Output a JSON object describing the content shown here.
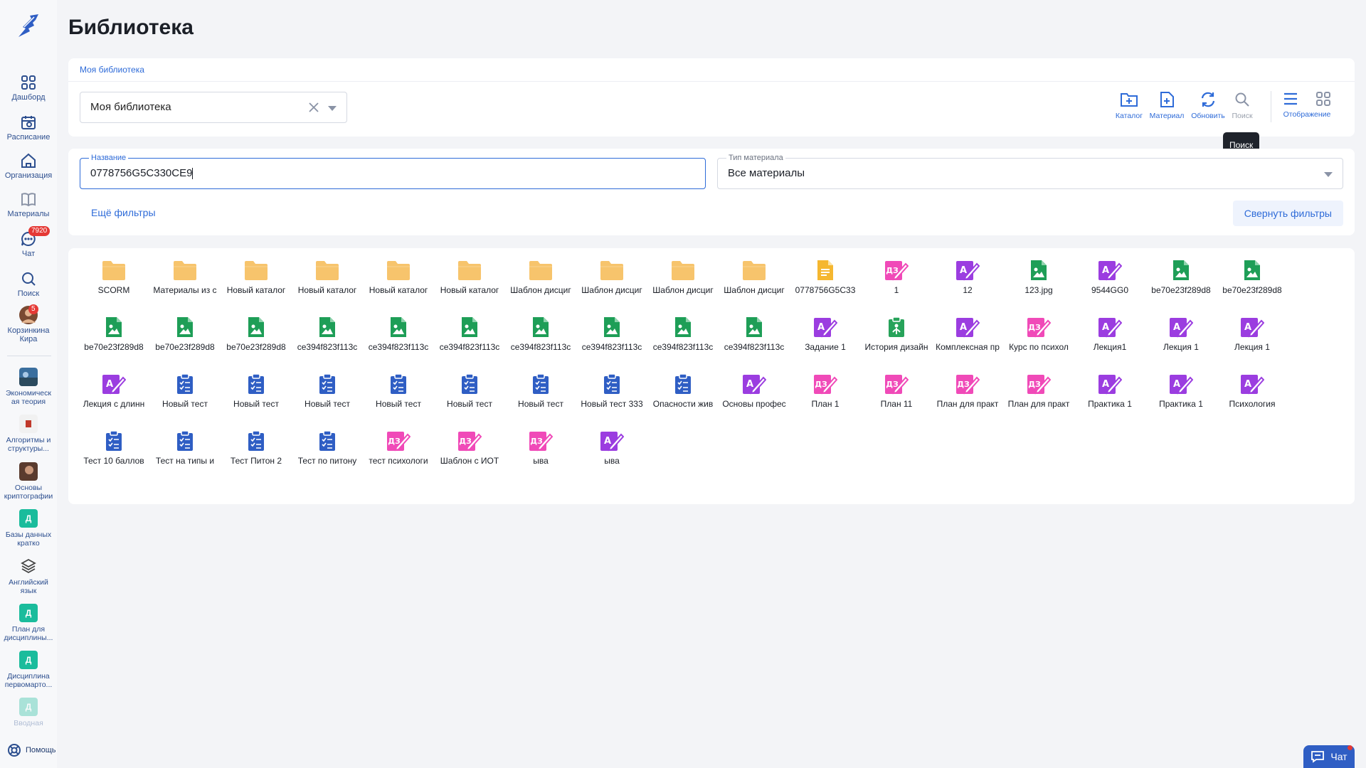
{
  "sidebar": {
    "nav": [
      {
        "label": "Дашборд",
        "icon": "dashboard-icon"
      },
      {
        "label": "Расписание",
        "icon": "calendar-icon"
      },
      {
        "label": "Организация",
        "icon": "home-icon"
      },
      {
        "label": "Материалы",
        "icon": "book-icon"
      },
      {
        "label": "Чат",
        "icon": "chat-icon",
        "badge": "7920"
      },
      {
        "label": "Поиск",
        "icon": "search-icon"
      },
      {
        "label": "Корзинкина Кира",
        "icon": "avatar",
        "badge": "5"
      }
    ],
    "courses": [
      {
        "label": "Экономическ ая теория"
      },
      {
        "label": "Алгоритмы и структуры..."
      },
      {
        "label": "Основы криптографии"
      },
      {
        "label": "Базы данных кратко",
        "letter": "Д"
      },
      {
        "label": "Английский язык"
      },
      {
        "label": "План для дисциплины...",
        "letter": "Д"
      },
      {
        "label": "Дисциплина первомарто...",
        "letter": "Д"
      },
      {
        "label": "Вводная",
        "letter": "Д"
      }
    ],
    "help_label": "Помощь"
  },
  "page_title": "Библиотека",
  "breadcrumb": "Моя библиотека",
  "library_select": "Моя библиотека",
  "toolbar": {
    "catalog": "Каталог",
    "material": "Материал",
    "refresh": "Обновить",
    "search": "Поиск",
    "display": "Отображение",
    "tooltip": "Поиск"
  },
  "filters": {
    "name_label": "Название",
    "name_value": "0778756G5C330CE9",
    "type_label": "Тип материала",
    "type_value": "Все материалы",
    "more_filters": "Ещё фильтры",
    "collapse": "Свернуть фильтры"
  },
  "items": [
    {
      "name": "SCORM",
      "type": "folder"
    },
    {
      "name": "Материалы из с",
      "type": "folder"
    },
    {
      "name": "Новый каталог",
      "type": "folder"
    },
    {
      "name": "Новый каталог",
      "type": "folder"
    },
    {
      "name": "Новый каталог",
      "type": "folder"
    },
    {
      "name": "Новый каталог",
      "type": "folder"
    },
    {
      "name": "Шаблон дисциг",
      "type": "folder"
    },
    {
      "name": "Шаблон дисциг",
      "type": "folder"
    },
    {
      "name": "Шаблон дисциг",
      "type": "folder"
    },
    {
      "name": "Шаблон дисциг",
      "type": "folder"
    },
    {
      "name": "0778756G5C33",
      "type": "doc"
    },
    {
      "name": "1",
      "type": "hw"
    },
    {
      "name": "12",
      "type": "lecture"
    },
    {
      "name": "123.jpg",
      "type": "image"
    },
    {
      "name": "9544GG0",
      "type": "lecture"
    },
    {
      "name": "be70e23f289d8",
      "type": "image"
    },
    {
      "name": "be70e23f289d8",
      "type": "image"
    },
    {
      "name": "be70e23f289d8",
      "type": "image"
    },
    {
      "name": "be70e23f289d8",
      "type": "image"
    },
    {
      "name": "be70e23f289d8",
      "type": "image"
    },
    {
      "name": "ce394f823f113c",
      "type": "image"
    },
    {
      "name": "ce394f823f113c",
      "type": "image"
    },
    {
      "name": "ce394f823f113c",
      "type": "image"
    },
    {
      "name": "ce394f823f113c",
      "type": "image"
    },
    {
      "name": "ce394f823f113c",
      "type": "image"
    },
    {
      "name": "ce394f823f113c",
      "type": "image"
    },
    {
      "name": "ce394f823f113c",
      "type": "image"
    },
    {
      "name": "Задание 1",
      "type": "lecture"
    },
    {
      "name": "История дизайн",
      "type": "scorm"
    },
    {
      "name": "Комплексная пр",
      "type": "lecture"
    },
    {
      "name": "Курс по психол",
      "type": "hw"
    },
    {
      "name": "Лекция1",
      "type": "lecture"
    },
    {
      "name": "Лекция 1",
      "type": "lecture"
    },
    {
      "name": "Лекция 1",
      "type": "lecture"
    },
    {
      "name": "Лекция с длинн",
      "type": "lecture"
    },
    {
      "name": "Новый тест",
      "type": "test"
    },
    {
      "name": "Новый тест",
      "type": "test"
    },
    {
      "name": "Новый тест",
      "type": "test"
    },
    {
      "name": "Новый тест",
      "type": "test"
    },
    {
      "name": "Новый тест",
      "type": "test"
    },
    {
      "name": "Новый тест",
      "type": "test"
    },
    {
      "name": "Новый тест 333",
      "type": "test"
    },
    {
      "name": "Опасности жив",
      "type": "test"
    },
    {
      "name": "Основы профес",
      "type": "lecture"
    },
    {
      "name": "План 1",
      "type": "hw"
    },
    {
      "name": "План 11",
      "type": "hw"
    },
    {
      "name": "План для практ",
      "type": "hw"
    },
    {
      "name": "План для практ",
      "type": "hw"
    },
    {
      "name": "Практика 1",
      "type": "lecture"
    },
    {
      "name": "Практика 1",
      "type": "lecture"
    },
    {
      "name": "Психология",
      "type": "lecture"
    },
    {
      "name": "Тест 10 баллов",
      "type": "test"
    },
    {
      "name": "Тест на типы и",
      "type": "test"
    },
    {
      "name": "Тест Питон 2",
      "type": "test"
    },
    {
      "name": "Тест по питону",
      "type": "test"
    },
    {
      "name": "тест психологи",
      "type": "hw"
    },
    {
      "name": "Шаблон с ИОТ",
      "type": "hw"
    },
    {
      "name": "ыва",
      "type": "hw"
    },
    {
      "name": "ыва",
      "type": "lecture"
    }
  ],
  "chat_button": "Чат",
  "colors": {
    "accent": "#2e6bd8",
    "folder": "#f7c46c",
    "doc": "#f5b730",
    "image": "#1e9e57",
    "lecture": "#9b3de0",
    "homework": "#f04ab8",
    "test": "#2f5ec4",
    "scorm": "#27a35a",
    "badge": "#e53935"
  }
}
